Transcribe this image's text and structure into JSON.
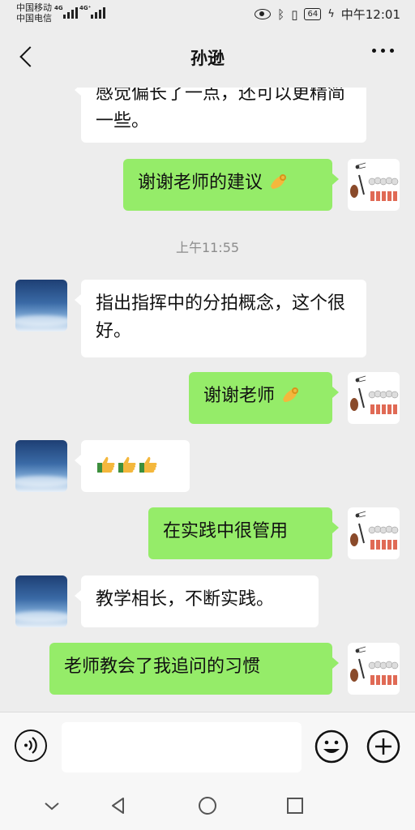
{
  "status": {
    "carrier1": "中国移动",
    "carrier2": "中国电信",
    "sig1_tag": "4G",
    "sig2_tag": "4G⁺",
    "battery": "64",
    "time": "中午12:01"
  },
  "header": {
    "title": "孙逊"
  },
  "messages": [
    {
      "side": "left",
      "text": "感觉偏长了一点，还可以更精简一些。"
    },
    {
      "side": "right",
      "text": "谢谢老师的建议",
      "emoji": "ok-hand-emoji"
    },
    {
      "time": "上午11:55"
    },
    {
      "side": "left",
      "text": "指出指挥中的分拍概念，这个很好。"
    },
    {
      "side": "right",
      "text": "谢谢老师",
      "emoji": "ok-hand-emoji"
    },
    {
      "side": "left",
      "emoji": "thumbs-up-emoji ×3"
    },
    {
      "side": "right",
      "text": "在实践中很管用"
    },
    {
      "side": "left",
      "text": "教学相长，不断实践。"
    },
    {
      "side": "right",
      "text": "老师教会了我追问的习惯"
    }
  ],
  "colors": {
    "background": "#ededed",
    "bubble_self": "#95ec69",
    "bubble_other": "#ffffff"
  },
  "icons": {
    "back": "back-arrow-icon",
    "more": "more-dots-icon",
    "voice": "voice-icon",
    "emoji": "emoji-icon",
    "plus": "plus-icon",
    "nav": [
      "nav-collapse-icon",
      "nav-back-icon",
      "nav-home-icon",
      "nav-recent-icon"
    ]
  }
}
